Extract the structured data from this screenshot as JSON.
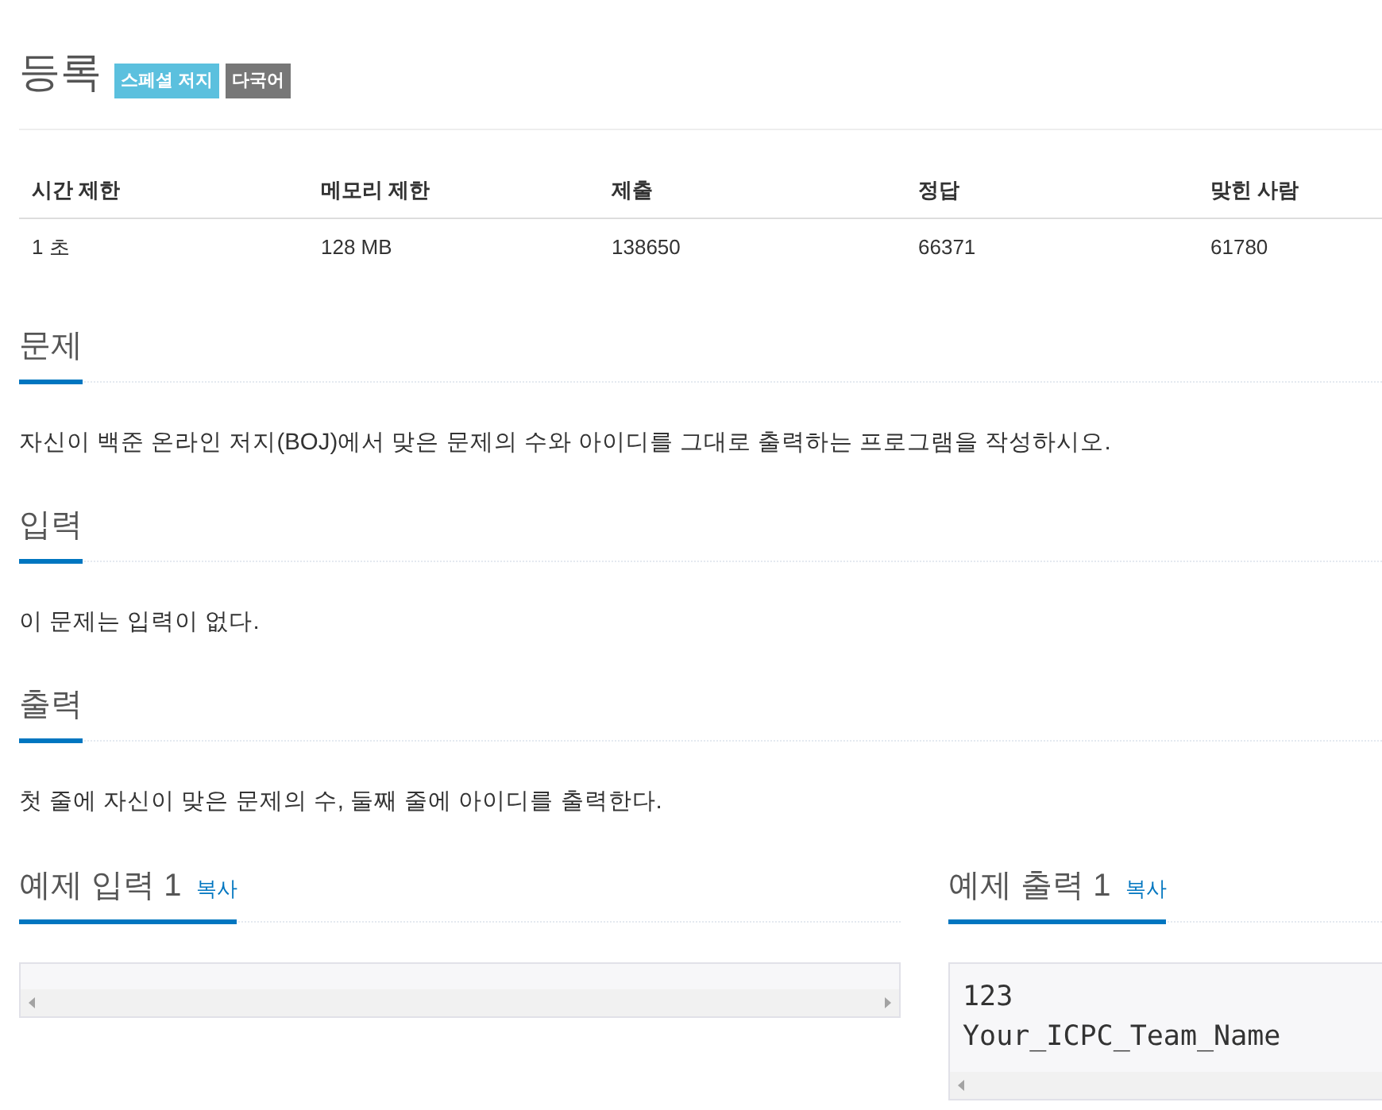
{
  "title": "등록",
  "badges": [
    {
      "label": "스페셜 저지",
      "color": "#5bc0de"
    },
    {
      "label": "다국어",
      "color": "#777777"
    }
  ],
  "info_table": {
    "columns": [
      "시간 제한",
      "메모리 제한",
      "제출",
      "정답",
      "맞힌 사람"
    ],
    "rows": [
      [
        "1 초",
        "128 MB",
        "138650",
        "66371",
        "61780"
      ]
    ]
  },
  "sections": [
    {
      "heading": "문제",
      "text": "자신이 백준 온라인 저지(BOJ)에서 맞은 문제의 수와 아이디를 그대로 출력하는 프로그램을 작성하시오."
    },
    {
      "heading": "입력",
      "text": "이 문제는 입력이 없다."
    },
    {
      "heading": "출력",
      "text": "첫 줄에 자신이 맞은 문제의 수, 둘째 줄에 아이디를 출력한다."
    }
  ],
  "samples": [
    {
      "heading": "예제 입력 1",
      "copy_link": "복사"
    },
    {
      "heading": "예제 출력 1",
      "copy_link": "복사",
      "lines": [
        "123",
        "Your_ICPC_Team_Name"
      ]
    }
  ]
}
